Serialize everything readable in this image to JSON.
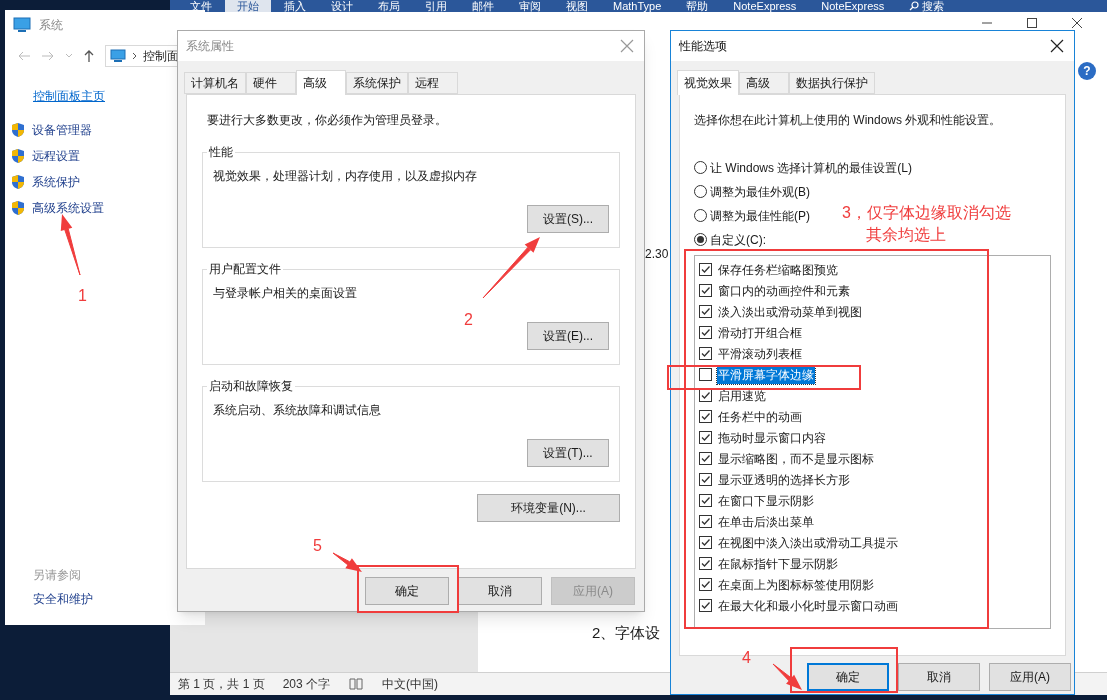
{
  "word": {
    "ribbon_tabs": [
      {
        "label": "文件",
        "selected": false
      },
      {
        "label": "开始",
        "selected": true
      },
      {
        "label": "插入",
        "selected": false
      },
      {
        "label": "设计",
        "selected": false
      },
      {
        "label": "布局",
        "selected": false
      },
      {
        "label": "引用",
        "selected": false
      },
      {
        "label": "邮件",
        "selected": false
      },
      {
        "label": "审阅",
        "selected": false
      },
      {
        "label": "视图",
        "selected": false
      },
      {
        "label": "MathType",
        "selected": false
      },
      {
        "label": "帮助",
        "selected": false
      },
      {
        "label": "NoteExpress",
        "selected": false
      },
      {
        "label": "NoteExpress",
        "selected": false
      }
    ],
    "search": "搜索",
    "help": "?",
    "page_fragment": "2.30",
    "body_text": "2、字体设",
    "status": [
      "第 1 页，共 1 页",
      "203 个字",
      "中文(中国)"
    ]
  },
  "system_window": {
    "title": "系统",
    "address": "控制面",
    "home_link": "控制面板主页",
    "tasks": [
      "设备管理器",
      "远程设置",
      "系统保护",
      "高级系统设置"
    ],
    "see_also": "另请参阅",
    "see_also_links": [
      "安全和维护"
    ]
  },
  "system_properties": {
    "title": "系统属性",
    "active": false,
    "tabs": [
      {
        "label": "计算机名",
        "selected": false
      },
      {
        "label": "硬件",
        "selected": false
      },
      {
        "label": "高级",
        "selected": true
      },
      {
        "label": "系统保护",
        "selected": false
      },
      {
        "label": "远程",
        "selected": false
      }
    ],
    "notice": "要进行大多数更改，你必须作为管理员登录。",
    "groups": [
      {
        "title": "性能",
        "description": "视觉效果，处理器计划，内存使用，以及虚拟内存",
        "button": "设置(S)..."
      },
      {
        "title": "用户配置文件",
        "description": "与登录帐户相关的桌面设置",
        "button": "设置(E)..."
      },
      {
        "title": "启动和故障恢复",
        "description": "系统启动、系统故障和调试信息",
        "button": "设置(T)..."
      }
    ],
    "env_button": "环境变量(N)...",
    "buttons": [
      {
        "label": "确定",
        "disabled": false
      },
      {
        "label": "取消",
        "disabled": false
      },
      {
        "label": "应用(A)",
        "disabled": true
      }
    ]
  },
  "performance_options": {
    "title": "性能选项",
    "active": true,
    "tabs": [
      {
        "label": "视觉效果",
        "selected": true
      },
      {
        "label": "高级",
        "selected": false
      },
      {
        "label": "数据执行保护",
        "selected": false
      }
    ],
    "intro": "选择你想在此计算机上使用的 Windows 外观和性能设置。",
    "radios": [
      {
        "label": "让 Windows 选择计算机的最佳设置(L)",
        "selected": false
      },
      {
        "label": "调整为最佳外观(B)",
        "selected": false
      },
      {
        "label": "调整为最佳性能(P)",
        "selected": false
      },
      {
        "label": "自定义(C):",
        "selected": true
      }
    ],
    "effects": [
      {
        "label": "保存任务栏缩略图预览",
        "checked": true,
        "selected": false
      },
      {
        "label": "窗口内的动画控件和元素",
        "checked": true,
        "selected": false
      },
      {
        "label": "淡入淡出或滑动菜单到视图",
        "checked": true,
        "selected": false
      },
      {
        "label": "滑动打开组合框",
        "checked": true,
        "selected": false
      },
      {
        "label": "平滑滚动列表框",
        "checked": true,
        "selected": false
      },
      {
        "label": "平滑屏幕字体边缘",
        "checked": false,
        "selected": true
      },
      {
        "label": "启用速览",
        "checked": true,
        "selected": false
      },
      {
        "label": "任务栏中的动画",
        "checked": true,
        "selected": false
      },
      {
        "label": "拖动时显示窗口内容",
        "checked": true,
        "selected": false
      },
      {
        "label": "显示缩略图，而不是显示图标",
        "checked": true,
        "selected": false
      },
      {
        "label": "显示亚透明的选择长方形",
        "checked": true,
        "selected": false
      },
      {
        "label": "在窗口下显示阴影",
        "checked": true,
        "selected": false
      },
      {
        "label": "在单击后淡出菜单",
        "checked": true,
        "selected": false
      },
      {
        "label": "在视图中淡入淡出或滑动工具提示",
        "checked": true,
        "selected": false
      },
      {
        "label": "在鼠标指针下显示阴影",
        "checked": true,
        "selected": false
      },
      {
        "label": "在桌面上为图标标签使用阴影",
        "checked": true,
        "selected": false
      },
      {
        "label": "在最大化和最小化时显示窗口动画",
        "checked": true,
        "selected": false
      }
    ],
    "buttons": [
      {
        "label": "确定",
        "focused": true
      },
      {
        "label": "取消",
        "focused": false
      },
      {
        "label": "应用(A)",
        "focused": false
      }
    ]
  },
  "annotations": [
    {
      "label": "1"
    },
    {
      "label": "2"
    },
    {
      "label": "3，仅字体边缘取消勾选",
      "note": "其余均选上"
    },
    {
      "label": "4"
    },
    {
      "label": "5"
    }
  ]
}
